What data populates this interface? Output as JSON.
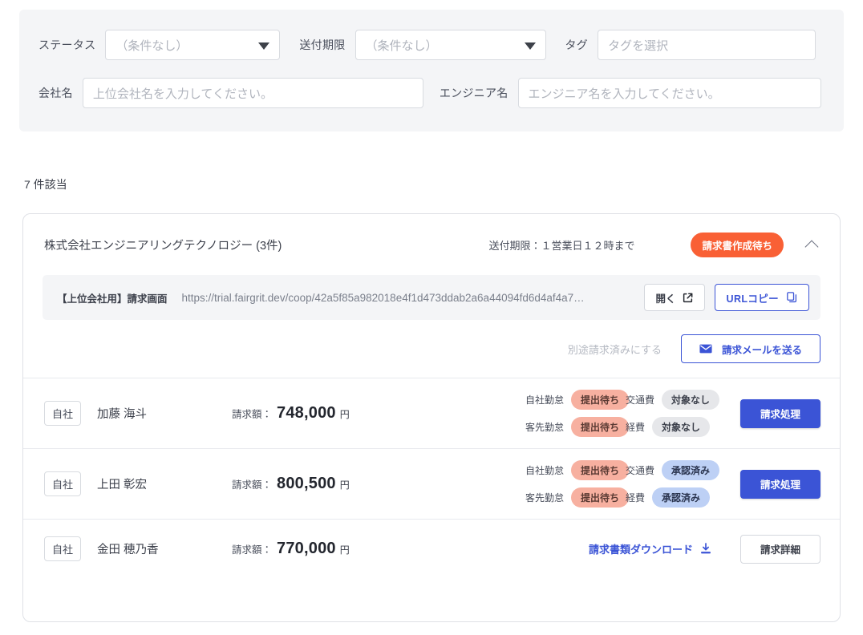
{
  "filters": {
    "status": {
      "label": "ステータス",
      "value": "（条件なし）",
      "icon": "chevron-down-icon"
    },
    "deadline": {
      "label": "送付期限",
      "value": "（条件なし）",
      "icon": "chevron-down-icon"
    },
    "tag": {
      "label": "タグ",
      "placeholder": "タグを選択",
      "value": ""
    },
    "company": {
      "label": "会社名",
      "placeholder": "上位会社名を入力してください。",
      "value": ""
    },
    "engineer": {
      "label": "エンジニア名",
      "placeholder": "エンジニア名を入力してください。",
      "value": ""
    }
  },
  "result_count": "7 件該当",
  "card": {
    "company_name": "株式会社エンジニアリングテクノロジー (3件)",
    "deadline_text": "送付期限：１営業日１２時まで",
    "status_badge": "請求書作成待ち",
    "collapse_icon": "chevron-up-icon",
    "url_row": {
      "label": "【上位会社用】請求画面",
      "url": "https://trial.fairgrit.dev/coop/42a5f85a982018e4f1d473ddab2a6a44094fd6d4af4a7…",
      "open_button": "開く",
      "open_icon": "external-link-icon",
      "copy_button": "URLコピー",
      "copy_icon": "copy-icon"
    },
    "actions": {
      "mark_separately_billed": "別途請求済みにする",
      "send_mail_button": "請求メールを送る",
      "send_mail_icon": "envelope-icon"
    },
    "rows": [
      {
        "company_tag": "自社",
        "engineer_name": "加藤 海斗",
        "amount_label": "請求額：",
        "amount": "748,000",
        "amount_unit": "円",
        "statuses": [
          {
            "label": "自社勤怠",
            "value": "提出待ち",
            "kind": "pending"
          },
          {
            "label": "交通費",
            "value": "対象なし",
            "kind": "none"
          },
          {
            "label": "客先勤怠",
            "value": "提出待ち",
            "kind": "pending"
          },
          {
            "label": "経費",
            "value": "対象なし",
            "kind": "none"
          }
        ],
        "action_button": "請求処理",
        "action_kind": "primary"
      },
      {
        "company_tag": "自社",
        "engineer_name": "上田 彰宏",
        "amount_label": "請求額：",
        "amount": "800,500",
        "amount_unit": "円",
        "statuses": [
          {
            "label": "自社勤怠",
            "value": "提出待ち",
            "kind": "pending"
          },
          {
            "label": "交通費",
            "value": "承認済み",
            "kind": "approved"
          },
          {
            "label": "客先勤怠",
            "value": "提出待ち",
            "kind": "pending"
          },
          {
            "label": "経費",
            "value": "承認済み",
            "kind": "approved"
          }
        ],
        "action_button": "請求処理",
        "action_kind": "primary"
      },
      {
        "company_tag": "自社",
        "engineer_name": "金田 穂乃香",
        "amount_label": "請求額：",
        "amount": "770,000",
        "amount_unit": "円",
        "download_link": "請求書類ダウンロード",
        "download_icon": "download-icon",
        "action_button": "請求詳細",
        "action_kind": "outline"
      }
    ]
  },
  "colors": {
    "accent_blue": "#3b54d6",
    "badge_orange": "#f96035",
    "badge_pending": "#f7b0a0",
    "badge_approved": "#bdd0f5",
    "badge_none": "#e6e7ea",
    "panel_gray": "#f4f5f7"
  }
}
